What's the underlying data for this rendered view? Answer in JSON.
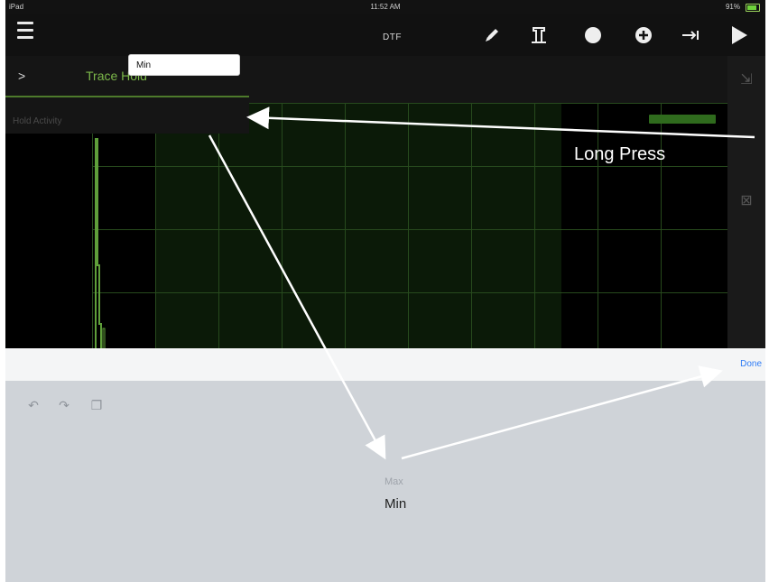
{
  "status_bar": {
    "left": "iPad",
    "time": "11:52 AM",
    "right": "91%"
  },
  "toolbar": {
    "menu_icon": "hamburger-menu-icon",
    "mode_label": "DTF",
    "icons": [
      "pencil-icon",
      "marker-icon",
      "record-icon",
      "add-circle-icon",
      "arrow-right-bar-icon",
      "play-icon"
    ]
  },
  "trace_panel": {
    "chevron": ">",
    "title": "Trace Hold",
    "field_label": "Hold Activity",
    "field_value": "Min"
  },
  "annotation": {
    "text": "Long Press"
  },
  "accessory_bar": {
    "done_label": "Done"
  },
  "keyboard_shortcuts": [
    "undo-icon",
    "redo-icon",
    "paste-icon"
  ],
  "picker": {
    "options": [
      "Max",
      "Min"
    ],
    "selected": "Min"
  },
  "colors": {
    "accent_green": "#7cb84a",
    "done_blue": "#2e7cf6",
    "keyboard_bg": "#cfd3d8"
  }
}
